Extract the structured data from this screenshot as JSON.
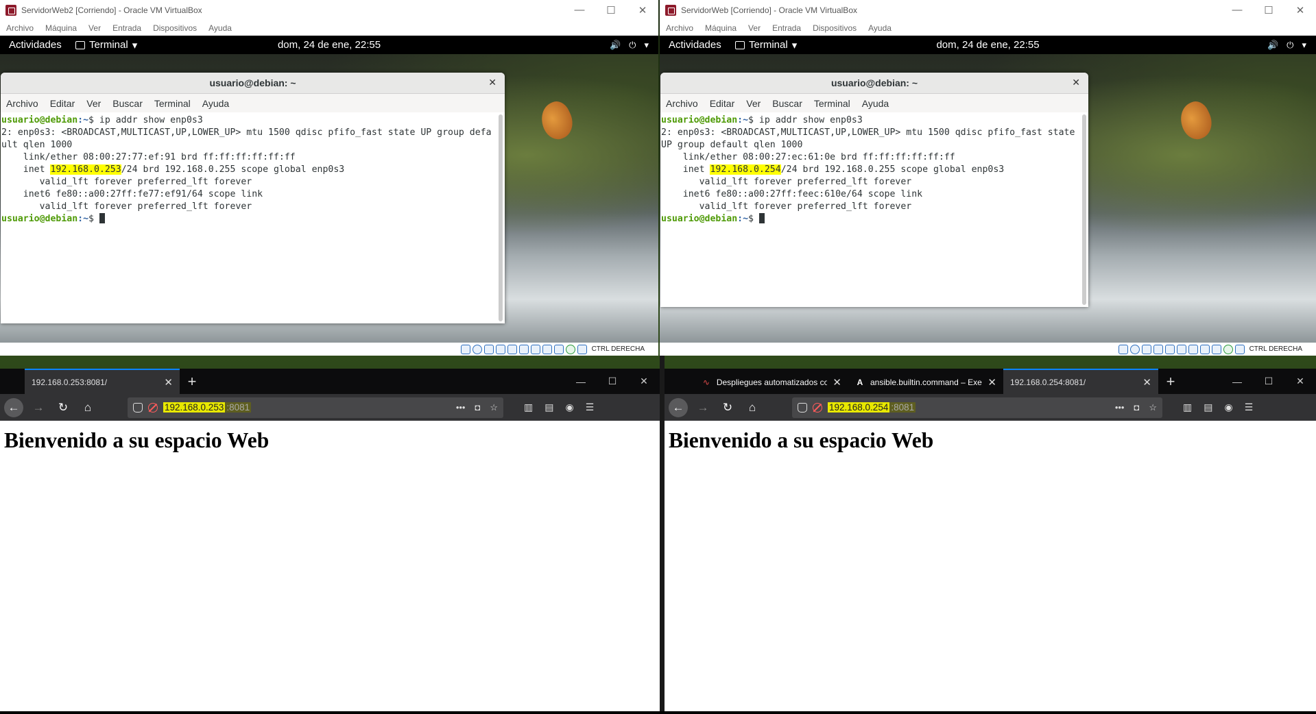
{
  "left_vm": {
    "window_title": "ServidorWeb2 [Corriendo] - Oracle VM VirtualBox",
    "menu": [
      "Archivo",
      "Máquina",
      "Ver",
      "Entrada",
      "Dispositivos",
      "Ayuda"
    ],
    "status_text": "CTRL DERECHA",
    "gnome": {
      "activities": "Actividades",
      "app": "Terminal",
      "clock": "dom, 24 de ene, 22:55"
    },
    "terminal": {
      "title": "usuario@debian: ~",
      "menu": [
        "Archivo",
        "Editar",
        "Ver",
        "Buscar",
        "Terminal",
        "Ayuda"
      ],
      "prompt_user": "usuario@debian",
      "prompt_path": ":~",
      "command": "$ ip addr show enp0s3",
      "line1": "2: enp0s3: <BROADCAST,MULTICAST,UP,LOWER_UP> mtu 1500 qdisc pfifo_fast state UP group default qlen 1000",
      "line2": "    link/ether 08:00:27:77:ef:91 brd ff:ff:ff:ff:ff:ff",
      "inet_prefix": "    inet ",
      "inet_ip": "192.168.0.253",
      "inet_suffix": "/24 brd 192.168.0.255 scope global enp0s3",
      "line4": "       valid_lft forever preferred_lft forever",
      "line5": "    inet6 fe80::a00:27ff:fe77:ef91/64 scope link",
      "line6": "       valid_lft forever preferred_lft forever",
      "final_prompt": "$ "
    }
  },
  "right_vm": {
    "window_title": "ServidorWeb [Corriendo] - Oracle VM VirtualBox",
    "menu": [
      "Archivo",
      "Máquina",
      "Ver",
      "Entrada",
      "Dispositivos",
      "Ayuda"
    ],
    "status_text": "CTRL DERECHA",
    "gnome": {
      "activities": "Actividades",
      "app": "Terminal",
      "clock": "dom, 24 de ene, 22:55"
    },
    "terminal": {
      "title": "usuario@debian: ~",
      "menu": [
        "Archivo",
        "Editar",
        "Ver",
        "Buscar",
        "Terminal",
        "Ayuda"
      ],
      "prompt_user": "usuario@debian",
      "prompt_path": ":~",
      "command": "$ ip addr show enp0s3",
      "line1": "2: enp0s3: <BROADCAST,MULTICAST,UP,LOWER_UP> mtu 1500 qdisc pfifo_fast state UP group default qlen 1000",
      "line2": "    link/ether 08:00:27:ec:61:0e brd ff:ff:ff:ff:ff:ff",
      "inet_prefix": "    inet ",
      "inet_ip": "192.168.0.254",
      "inet_suffix": "/24 brd 192.168.0.255 scope global enp0s3",
      "line4": "       valid_lft forever preferred_lft forever",
      "line5": "    inet6 fe80::a00:27ff:feec:610e/64 scope link",
      "line6": "       valid_lft forever preferred_lft forever",
      "final_prompt": "$ "
    }
  },
  "left_browser": {
    "tabs": [
      {
        "label": "192.168.0.253:8081/",
        "active": true
      }
    ],
    "url_host": "192.168.0.253",
    "url_port": ":8081",
    "heading": "Bienvenido a su espacio Web"
  },
  "right_browser": {
    "tabs": [
      {
        "label": "Despliegues automatizados co",
        "icon": "∿"
      },
      {
        "label": "ansible.builtin.command – Exe",
        "icon": "A"
      },
      {
        "label": "192.168.0.254:8081/",
        "active": true
      }
    ],
    "url_host": "192.168.0.254",
    "url_port": ":8081",
    "heading": "Bienvenido a su espacio Web"
  },
  "colors": {
    "highlight": "#ffff00",
    "prompt_user": "#4e9a06",
    "prompt_path": "#3465a4",
    "tab_accent": "#0a84ff"
  }
}
